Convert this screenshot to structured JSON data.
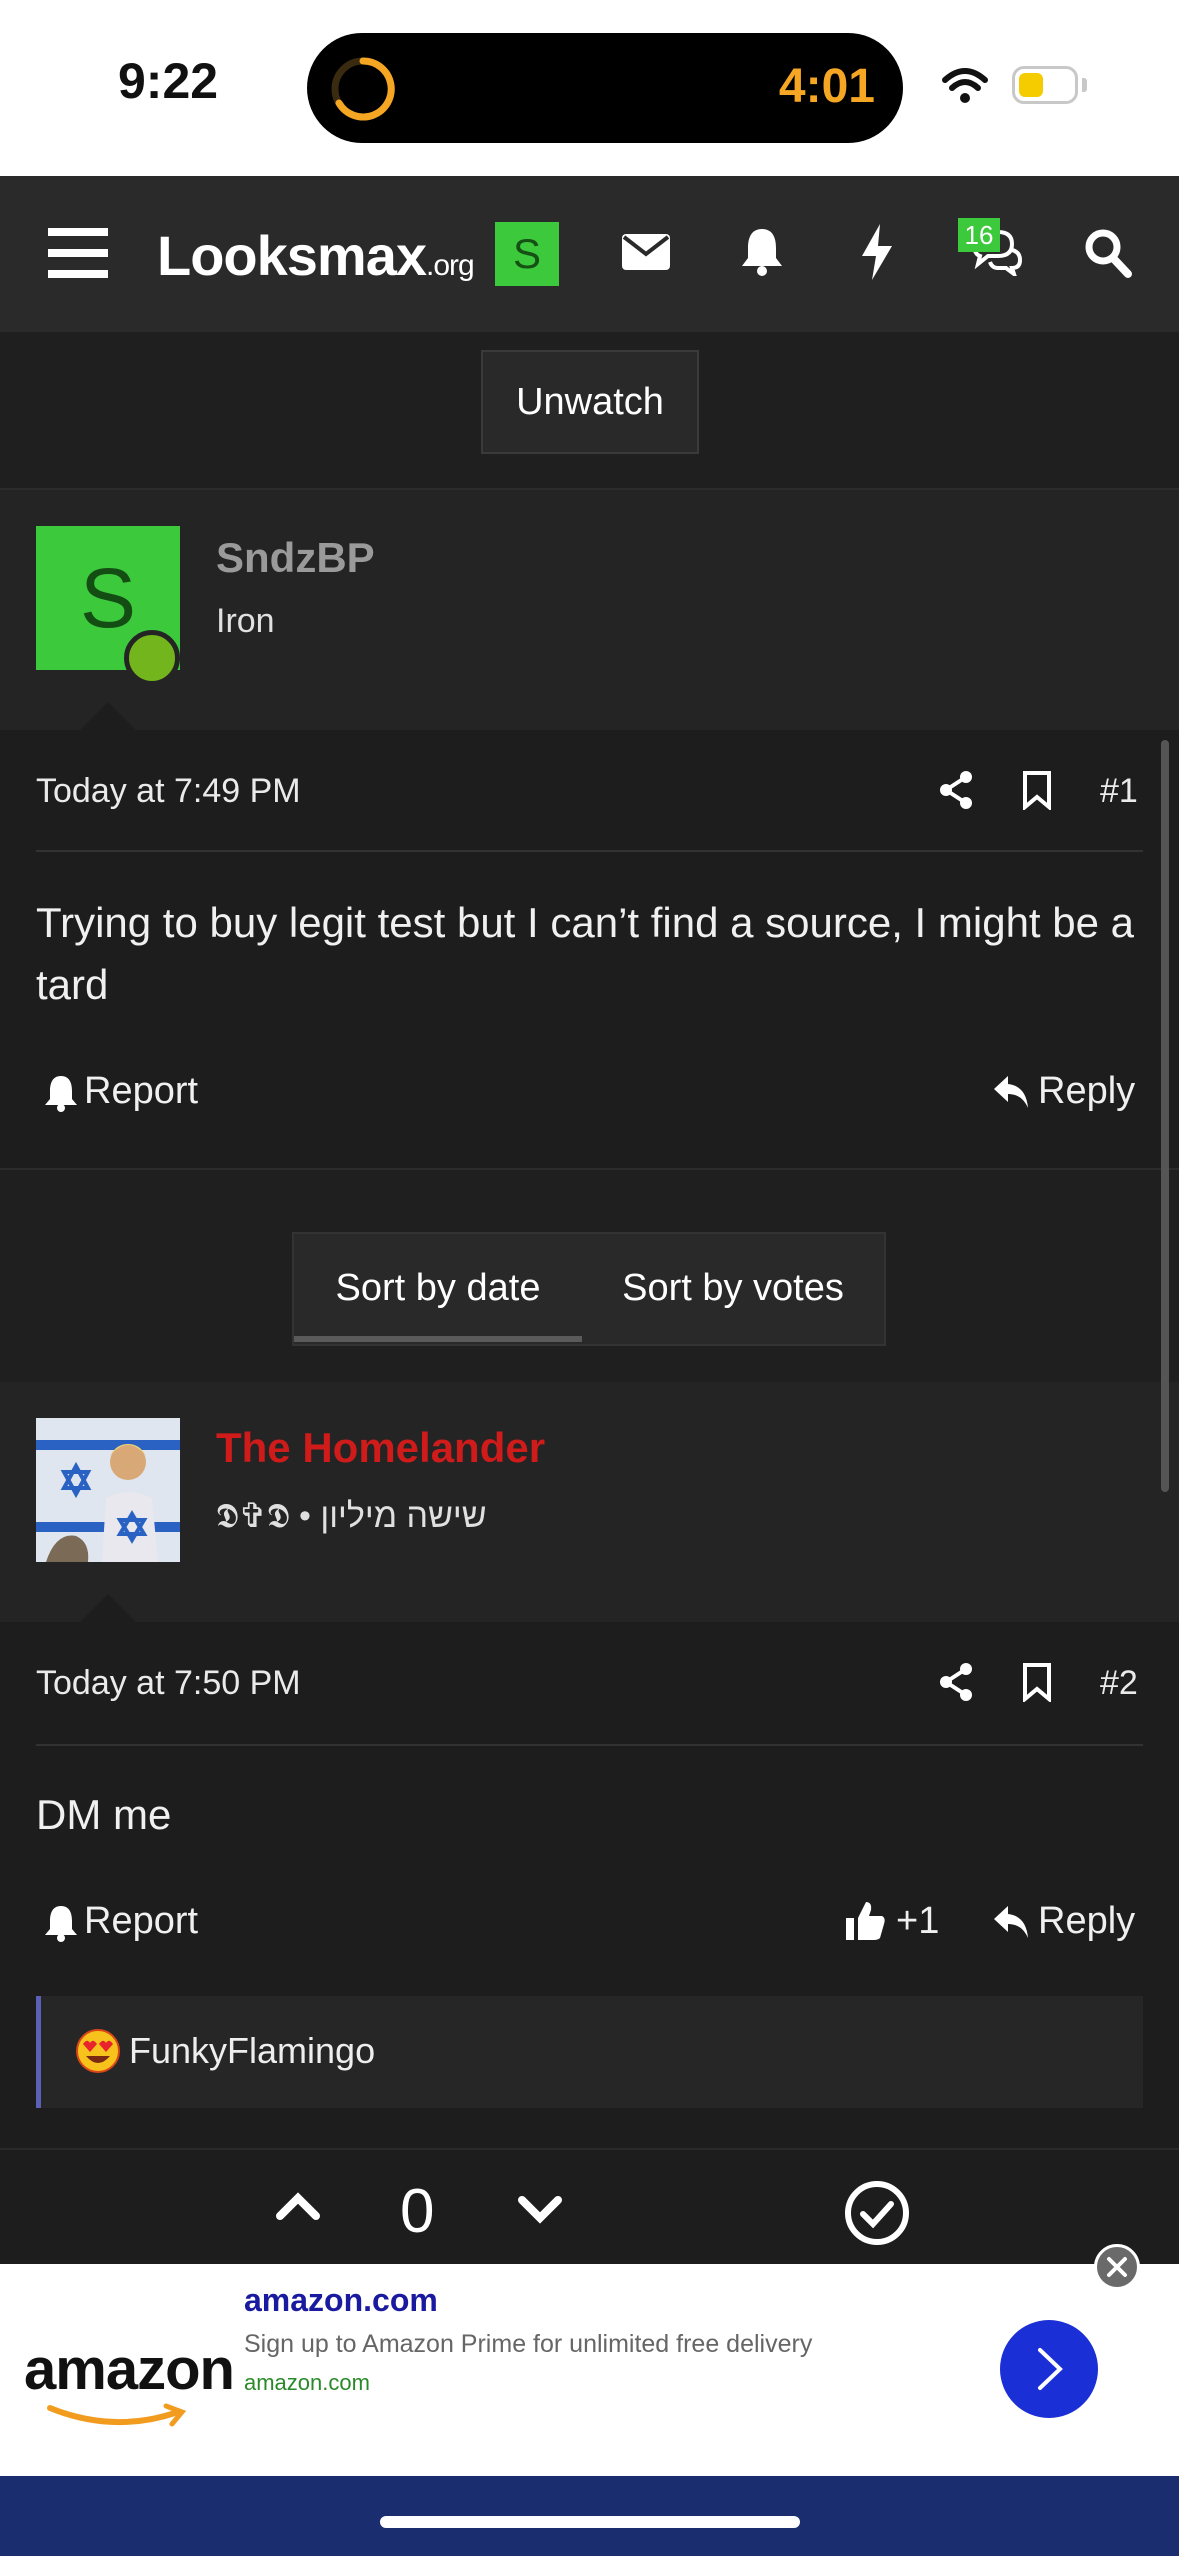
{
  "status_bar": {
    "time": "9:22",
    "timer": "4:01"
  },
  "navbar": {
    "logo_main": "Looksmax",
    "logo_suffix": ".org",
    "user_initial": "S",
    "conversations_badge": "16"
  },
  "thread": {
    "unwatch_label": "Unwatch"
  },
  "posts": [
    {
      "username": "SndzBP",
      "user_title": "Iron",
      "avatar_initial": "S",
      "date": "Today at 7:49 PM",
      "number": "#1",
      "body": "Trying to buy legit test but I can’t find a source, I might be a tard",
      "report_label": "Report",
      "reply_label": "Reply"
    },
    {
      "username": "The Homelander",
      "user_title": "𝕯✞𝕯 • שישה מיליון",
      "date": "Today at 7:50 PM",
      "number": "#2",
      "body": "DM me",
      "report_label": "Report",
      "reply_label": "Reply",
      "like_count": "+1",
      "reaction_user": "FunkyFlamingo"
    }
  ],
  "sort": {
    "by_date": "Sort by date",
    "by_votes": "Sort by votes",
    "active": "Sort by date"
  },
  "vote": {
    "count": "0"
  },
  "ad": {
    "logo": "amazon",
    "title": "amazon.com",
    "description": "Sign up to Amazon Prime for unlimited free delivery",
    "url": "amazon.com"
  },
  "colors": {
    "accent_green": "#3cc93c",
    "username_red": "#d01b1b",
    "ad_blue": "#1b2fd6"
  }
}
